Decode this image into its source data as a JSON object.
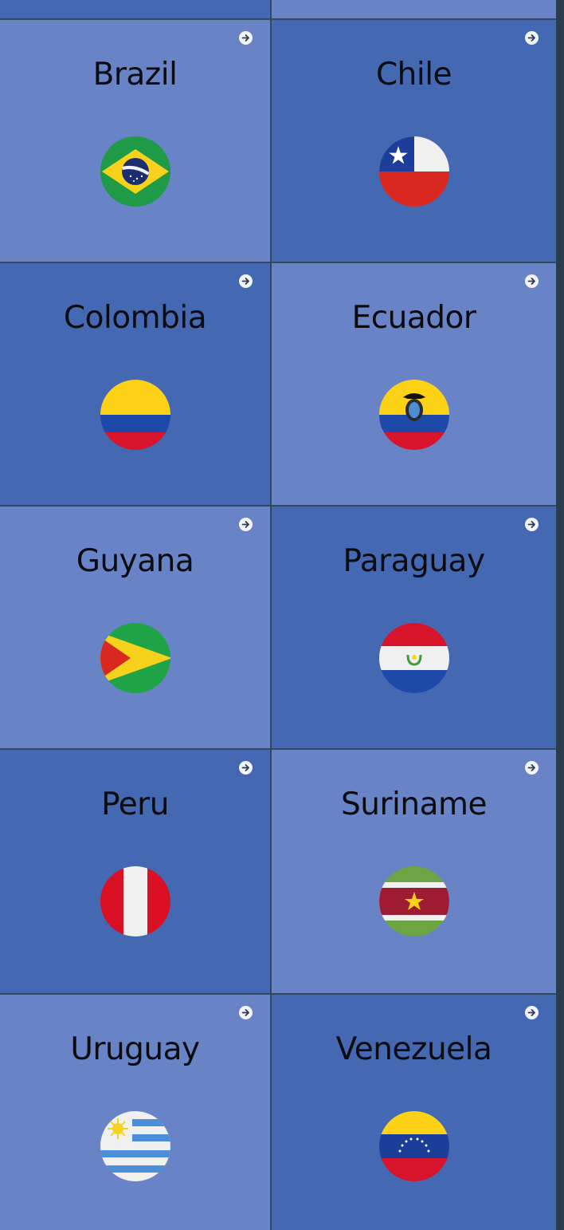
{
  "countries": [
    {
      "name": "Brazil",
      "flag_icon": "brazil-flag-icon"
    },
    {
      "name": "Chile",
      "flag_icon": "chile-flag-icon"
    },
    {
      "name": "Colombia",
      "flag_icon": "colombia-flag-icon"
    },
    {
      "name": "Ecuador",
      "flag_icon": "ecuador-flag-icon"
    },
    {
      "name": "Guyana",
      "flag_icon": "guyana-flag-icon"
    },
    {
      "name": "Paraguay",
      "flag_icon": "paraguay-flag-icon"
    },
    {
      "name": "Peru",
      "flag_icon": "peru-flag-icon"
    },
    {
      "name": "Suriname",
      "flag_icon": "suriname-flag-icon"
    },
    {
      "name": "Uruguay",
      "flag_icon": "uruguay-flag-icon"
    },
    {
      "name": "Venezuela",
      "flag_icon": "venezuela-flag-icon"
    }
  ],
  "tile_link_icon": "arrow-right-circle-icon",
  "colors": {
    "tile_light": "#6883c6",
    "tile_dark": "#4468b2",
    "divider": "#2c3440",
    "text": "#0b0b10"
  }
}
